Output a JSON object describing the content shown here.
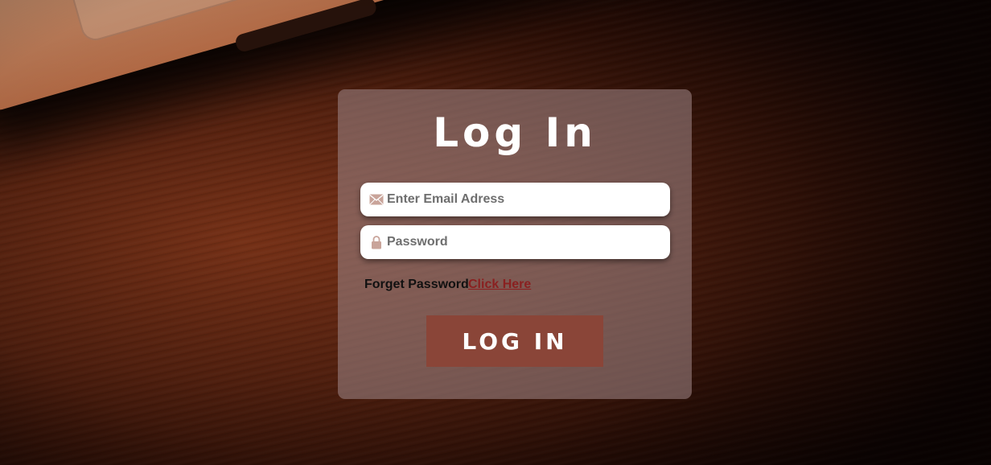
{
  "form": {
    "title": "Log In",
    "email": {
      "placeholder": "Enter Email Adress",
      "icon": "envelope-icon"
    },
    "password": {
      "placeholder": "Password",
      "icon": "lock-icon"
    },
    "forget_text": "Forget Password",
    "forget_link": "Click Here",
    "submit_label": "LOG IN"
  },
  "colors": {
    "card": "#967d7d",
    "button": "#8a4538",
    "link": "#8a2020",
    "icon": "#c9a49a"
  }
}
